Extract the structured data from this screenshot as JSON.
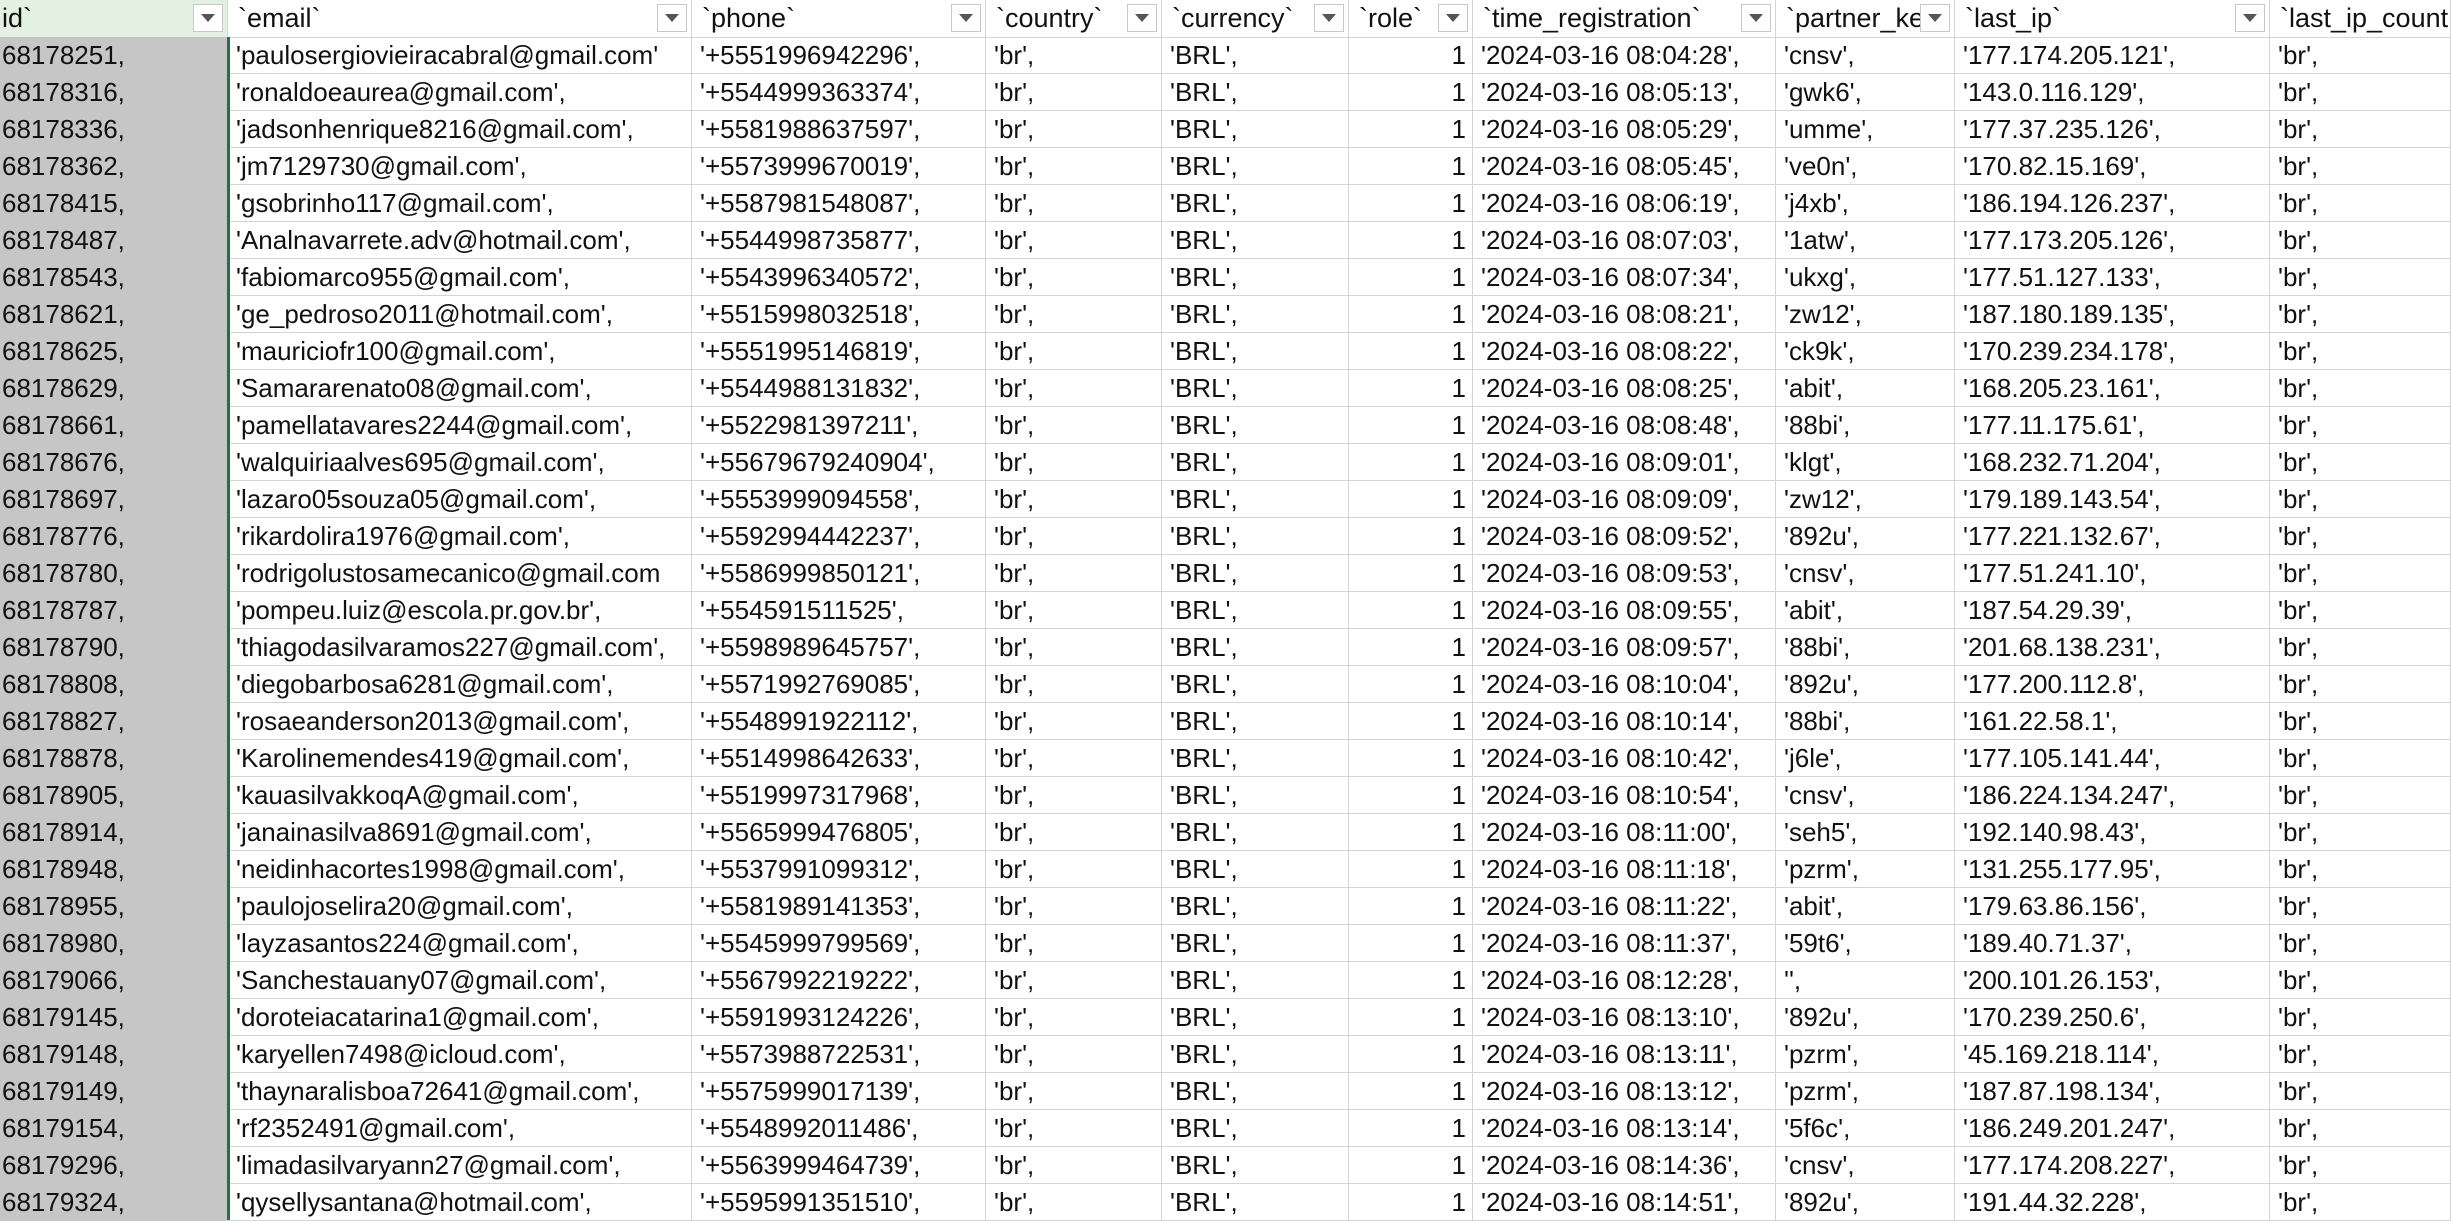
{
  "columns": [
    {
      "key": "id",
      "label": "id`"
    },
    {
      "key": "email",
      "label": "`email`"
    },
    {
      "key": "phone",
      "label": "`phone`"
    },
    {
      "key": "country",
      "label": "`country`"
    },
    {
      "key": "currency",
      "label": "`currency`"
    },
    {
      "key": "role",
      "label": "`role`"
    },
    {
      "key": "time_registration",
      "label": "`time_registration`"
    },
    {
      "key": "partner_key",
      "label": "`partner_ke"
    },
    {
      "key": "last_ip",
      "label": "`last_ip`"
    },
    {
      "key": "last_ip_country",
      "label": "`last_ip_count"
    }
  ],
  "filter_icon": "dropdown-triangle-icon",
  "rows": [
    [
      "68178251,",
      "'paulosergiovieiracabral@gmail.com'",
      "'+5551996942296',",
      "'br',",
      "'BRL',",
      "1",
      "'2024-03-16 08:04:28',",
      "'cnsv',",
      "'177.174.205.121',",
      "'br',"
    ],
    [
      "68178316,",
      "'ronaldoeaurea@gmail.com',",
      "'+5544999363374',",
      "'br',",
      "'BRL',",
      "1",
      "'2024-03-16 08:05:13',",
      "'gwk6',",
      "'143.0.116.129',",
      "'br',"
    ],
    [
      "68178336,",
      "'jadsonhenrique8216@gmail.com',",
      "'+5581988637597',",
      "'br',",
      "'BRL',",
      "1",
      "'2024-03-16 08:05:29',",
      "'umme',",
      "'177.37.235.126',",
      "'br',"
    ],
    [
      "68178362,",
      "'jm7129730@gmail.com',",
      "'+5573999670019',",
      "'br',",
      "'BRL',",
      "1",
      "'2024-03-16 08:05:45',",
      "'ve0n',",
      "'170.82.15.169',",
      "'br',"
    ],
    [
      "68178415,",
      "'gsobrinho117@gmail.com',",
      "'+5587981548087',",
      "'br',",
      "'BRL',",
      "1",
      "'2024-03-16 08:06:19',",
      "'j4xb',",
      "'186.194.126.237',",
      "'br',"
    ],
    [
      "68178487,",
      "'Analnavarrete.adv@hotmail.com',",
      "'+5544998735877',",
      "'br',",
      "'BRL',",
      "1",
      "'2024-03-16 08:07:03',",
      "'1atw',",
      "'177.173.205.126',",
      "'br',"
    ],
    [
      "68178543,",
      "'fabiomarco955@gmail.com',",
      "'+5543996340572',",
      "'br',",
      "'BRL',",
      "1",
      "'2024-03-16 08:07:34',",
      "'ukxg',",
      "'177.51.127.133',",
      "'br',"
    ],
    [
      "68178621,",
      "'ge_pedroso2011@hotmail.com',",
      "'+5515998032518',",
      "'br',",
      "'BRL',",
      "1",
      "'2024-03-16 08:08:21',",
      "'zw12',",
      "'187.180.189.135',",
      "'br',"
    ],
    [
      "68178625,",
      "'mauriciofr100@gmail.com',",
      "'+5551995146819',",
      "'br',",
      "'BRL',",
      "1",
      "'2024-03-16 08:08:22',",
      "'ck9k',",
      "'170.239.234.178',",
      "'br',"
    ],
    [
      "68178629,",
      "'Samararenato08@gmail.com',",
      "'+5544988131832',",
      "'br',",
      "'BRL',",
      "1",
      "'2024-03-16 08:08:25',",
      "'abit',",
      "'168.205.23.161',",
      "'br',"
    ],
    [
      "68178661,",
      "'pamellatavares2244@gmail.com',",
      "'+5522981397211',",
      "'br',",
      "'BRL',",
      "1",
      "'2024-03-16 08:08:48',",
      "'88bi',",
      "'177.11.175.61',",
      "'br',"
    ],
    [
      "68178676,",
      "'walquiriaalves695@gmail.com',",
      "'+55679679240904',",
      "'br',",
      "'BRL',",
      "1",
      "'2024-03-16 08:09:01',",
      "'klgt',",
      "'168.232.71.204',",
      "'br',"
    ],
    [
      "68178697,",
      "'lazaro05souza05@gmail.com',",
      "'+5553999094558',",
      "'br',",
      "'BRL',",
      "1",
      "'2024-03-16 08:09:09',",
      "'zw12',",
      "'179.189.143.54',",
      "'br',"
    ],
    [
      "68178776,",
      "'rikardolira1976@gmail.com',",
      "'+5592994442237',",
      "'br',",
      "'BRL',",
      "1",
      "'2024-03-16 08:09:52',",
      "'892u',",
      "'177.221.132.67',",
      "'br',"
    ],
    [
      "68178780,",
      "'rodrigolustosamecanico@gmail.com",
      "'+5586999850121',",
      "'br',",
      "'BRL',",
      "1",
      "'2024-03-16 08:09:53',",
      "'cnsv',",
      "'177.51.241.10',",
      "'br',"
    ],
    [
      "68178787,",
      "'pompeu.luiz@escola.pr.gov.br',",
      "'+554591511525',",
      "'br',",
      "'BRL',",
      "1",
      "'2024-03-16 08:09:55',",
      "'abit',",
      "'187.54.29.39',",
      "'br',"
    ],
    [
      "68178790,",
      "'thiagodasilvaramos227@gmail.com',",
      "'+5598989645757',",
      "'br',",
      "'BRL',",
      "1",
      "'2024-03-16 08:09:57',",
      "'88bi',",
      "'201.68.138.231',",
      "'br',"
    ],
    [
      "68178808,",
      "'diegobarbosa6281@gmail.com',",
      "'+5571992769085',",
      "'br',",
      "'BRL',",
      "1",
      "'2024-03-16 08:10:04',",
      "'892u',",
      "'177.200.112.8',",
      "'br',"
    ],
    [
      "68178827,",
      "'rosaeanderson2013@gmail.com',",
      "'+5548991922112',",
      "'br',",
      "'BRL',",
      "1",
      "'2024-03-16 08:10:14',",
      "'88bi',",
      "'161.22.58.1',",
      "'br',"
    ],
    [
      "68178878,",
      "'Karolinemendes419@gmail.com',",
      "'+5514998642633',",
      "'br',",
      "'BRL',",
      "1",
      "'2024-03-16 08:10:42',",
      "'j6le',",
      "'177.105.141.44',",
      "'br',"
    ],
    [
      "68178905,",
      "'kauasilvakkoqA@gmail.com',",
      "'+5519997317968',",
      "'br',",
      "'BRL',",
      "1",
      "'2024-03-16 08:10:54',",
      "'cnsv',",
      "'186.224.134.247',",
      "'br',"
    ],
    [
      "68178914,",
      "'janainasilva8691@gmail.com',",
      "'+5565999476805',",
      "'br',",
      "'BRL',",
      "1",
      "'2024-03-16 08:11:00',",
      "'seh5',",
      "'192.140.98.43',",
      "'br',"
    ],
    [
      "68178948,",
      "'neidinhacortes1998@gmail.com',",
      "'+5537991099312',",
      "'br',",
      "'BRL',",
      "1",
      "'2024-03-16 08:11:18',",
      "'pzrm',",
      "'131.255.177.95',",
      "'br',"
    ],
    [
      "68178955,",
      "'paulojoselira20@gmail.com',",
      "'+5581989141353',",
      "'br',",
      "'BRL',",
      "1",
      "'2024-03-16 08:11:22',",
      "'abit',",
      "'179.63.86.156',",
      "'br',"
    ],
    [
      "68178980,",
      "'layzasantos224@gmail.com',",
      "'+5545999799569',",
      "'br',",
      "'BRL',",
      "1",
      "'2024-03-16 08:11:37',",
      "'59t6',",
      "'189.40.71.37',",
      "'br',"
    ],
    [
      "68179066,",
      "'Sanchestauany07@gmail.com',",
      "'+5567992219222',",
      "'br',",
      "'BRL',",
      "1",
      "'2024-03-16 08:12:28',",
      "'',",
      "'200.101.26.153',",
      "'br',"
    ],
    [
      "68179145,",
      "'doroteiacatarina1@gmail.com',",
      "'+5591993124226',",
      "'br',",
      "'BRL',",
      "1",
      "'2024-03-16 08:13:10',",
      "'892u',",
      "'170.239.250.6',",
      "'br',"
    ],
    [
      "68179148,",
      "'karyellen7498@icloud.com',",
      "'+5573988722531',",
      "'br',",
      "'BRL',",
      "1",
      "'2024-03-16 08:13:11',",
      "'pzrm',",
      "'45.169.218.114',",
      "'br',"
    ],
    [
      "68179149,",
      "'thaynaralisboa72641@gmail.com',",
      "'+5575999017139',",
      "'br',",
      "'BRL',",
      "1",
      "'2024-03-16 08:13:12',",
      "'pzrm',",
      "'187.87.198.134',",
      "'br',"
    ],
    [
      "68179154,",
      "'rf2352491@gmail.com',",
      "'+5548992011486',",
      "'br',",
      "'BRL',",
      "1",
      "'2024-03-16 08:13:14',",
      "'5f6c',",
      "'186.249.201.247',",
      "'br',"
    ],
    [
      "68179296,",
      "'limadasilvaryann27@gmail.com',",
      "'+5563999464739',",
      "'br',",
      "'BRL',",
      "1",
      "'2024-03-16 08:14:36',",
      "'cnsv',",
      "'177.174.208.227',",
      "'br',"
    ],
    [
      "68179324,",
      "'qysellysantana@hotmail.com',",
      "'+5595991351510',",
      "'br',",
      "'BRL',",
      "1",
      "'2024-03-16 08:14:51',",
      "'892u',",
      "'191.44.32.228',",
      "'br',"
    ]
  ]
}
